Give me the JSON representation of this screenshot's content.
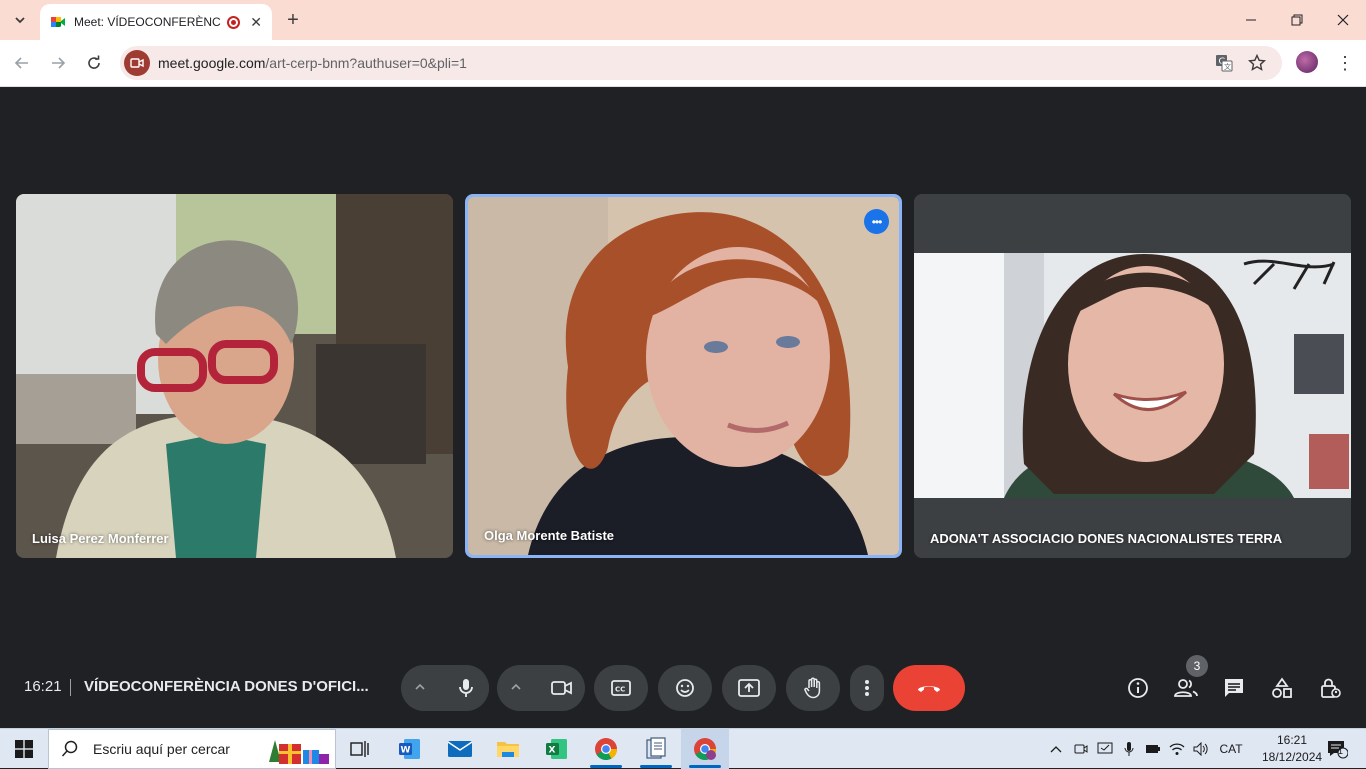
{
  "browser": {
    "tab": {
      "title": "Meet: VÍDEOCONFERÈNCIA DONES D'OFICI",
      "new_tab_label": "+"
    },
    "url": {
      "host": "meet.google.com",
      "path": "/art-cerp-bnm?authuser=0&pli=1"
    },
    "window_controls": [
      "minimize",
      "restore",
      "close"
    ]
  },
  "meeting": {
    "time": "16:21",
    "title": "VÍDEOCONFERÈNCIA DONES D'OFICI...",
    "participants_count": "3",
    "participants": [
      {
        "name": "Luisa Perez Monferrer",
        "active": false
      },
      {
        "name": "Olga Morente Batiste",
        "active": true
      },
      {
        "name": "ADONA'T ASSOCIACIO DONES NACIONALISTES TERRA",
        "active": false
      }
    ],
    "end_call_color": "#ea4335",
    "accent": "#1a73e8"
  },
  "taskbar": {
    "search_placeholder": "Escriu aquí per cercar",
    "language": "CAT",
    "time": "16:21",
    "date": "18/12/2024",
    "notifications_count": "1"
  }
}
